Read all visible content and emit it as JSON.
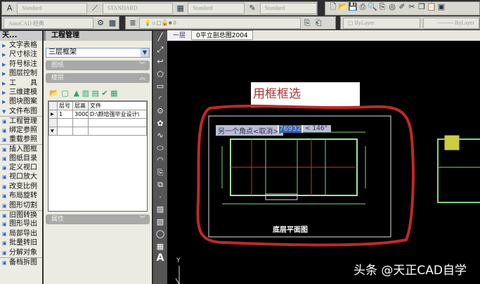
{
  "toolbar": {
    "text_style": "Standard",
    "dim_style": "STANDARD",
    "table_style": "Standard",
    "mleader_style": "Standard",
    "workspace": "AutoCAD 经典",
    "layer": "0",
    "color": "ByLayer",
    "linetype": "ByLayer"
  },
  "left_menu": {
    "title": "天...",
    "items": [
      "文字表格",
      "尺寸标注",
      "符号标注",
      "图层控制",
      "工　　具",
      "三维建模",
      "图块图案",
      "文件布图",
      "工程管理",
      "绑定参照",
      "重载参照",
      "插入图框",
      "图纸目录",
      "定义视口",
      "视口放大",
      "改变比例",
      "布局旋转",
      "图形切割",
      "旧图转换",
      "图形导出",
      "局部导出",
      "批量转旧",
      "分解对象",
      "备档拆图"
    ]
  },
  "panel": {
    "title": "工程管理",
    "project": "三层框架",
    "sections": {
      "drawings": "图纸",
      "floors": "楼层",
      "properties": "属性"
    },
    "table": {
      "headers": [
        "层号",
        "层高",
        "文件"
      ],
      "rows": [
        [
          "1",
          "3000",
          "D:\\颜培强毕业设计\\"
        ]
      ]
    }
  },
  "tabs": [
    "一层",
    "0平立剖总图2004"
  ],
  "canvas": {
    "annotation": "用框框选",
    "prompt": "另一个角点<取消>:",
    "value": "76932",
    "angle": "< 146°",
    "plan_title": "底层平面图",
    "y_axis": "Y",
    "highlight_color": "#c0282a"
  },
  "watermark": "头条 @天正CAD自学"
}
